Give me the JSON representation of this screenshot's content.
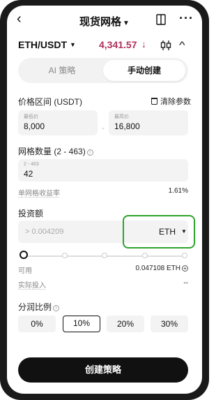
{
  "header": {
    "back_icon": "chevron-left-icon",
    "title": "现货网格",
    "title_caret": "▼",
    "book_icon": "book-icon",
    "more_icon": "more-icon"
  },
  "pair": {
    "symbol": "ETH/USDT",
    "caret": "▼",
    "price": "4,341.57",
    "trend": "down",
    "price_color": "#b0305a"
  },
  "tabs": [
    {
      "label": "AI 策略",
      "active": false
    },
    {
      "label": "手动创建",
      "active": true
    }
  ],
  "price_range": {
    "label": "价格区间 (USDT)",
    "clear_label": "清除参数",
    "min": {
      "label": "最低价",
      "value": "8,000"
    },
    "separator": "-",
    "max": {
      "label": "最高价",
      "value": "16,800"
    }
  },
  "grid_count": {
    "label": "网格数量 (2 - 463)",
    "field_label": "2 - 463",
    "value": "42"
  },
  "yield": {
    "label": "单网格收益率",
    "value": "1.61%"
  },
  "investment": {
    "label": "投资额",
    "placeholder": "> 0.004209",
    "coin": "ETH",
    "coin_caret": "▼",
    "highlight_color": "#2ea32e",
    "slider_level": 0,
    "available_label": "可用",
    "available_value": "0.047108 ETH",
    "actual_label": "实际投入",
    "actual_value": "--"
  },
  "profit_share": {
    "label": "分润比例",
    "options": [
      {
        "label": "0%",
        "selected": false
      },
      {
        "label": "10%",
        "selected": true
      },
      {
        "label": "20%",
        "selected": false
      },
      {
        "label": "30%",
        "selected": false
      }
    ]
  },
  "submit_label": "创建策略"
}
